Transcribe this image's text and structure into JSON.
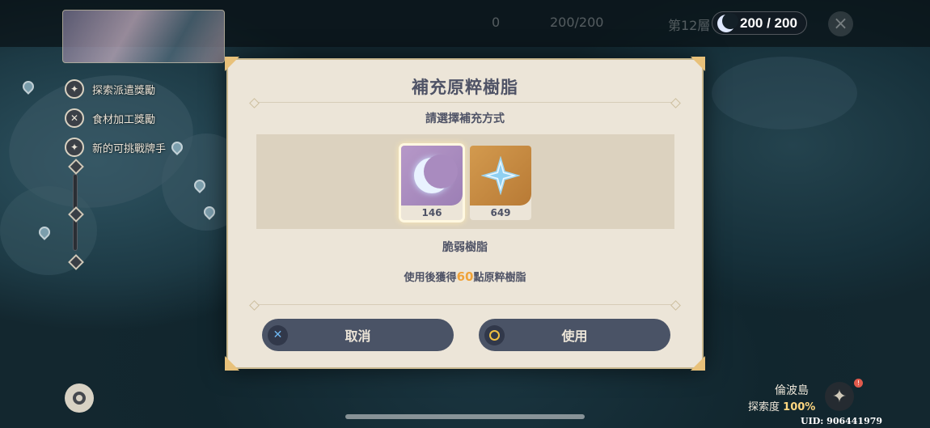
{
  "top_bar": {
    "dim_primo": "0",
    "dim_resin": "200/200",
    "dim_floor": "第12層",
    "resin_display": "200 / 200"
  },
  "left_menu": {
    "items": [
      {
        "label": "探索派遣獎勵",
        "icon": "compass-icon"
      },
      {
        "label": "食材加工獎勵",
        "icon": "cooking-icon"
      },
      {
        "label": "新的可挑戰牌手",
        "icon": "card-icon"
      }
    ]
  },
  "dialog": {
    "title": "補充原粹樹脂",
    "subtitle": "請選擇補充方式",
    "options": [
      {
        "name": "fragile-resin",
        "count": "146",
        "selected": true,
        "icon": "crescent-moon-icon"
      },
      {
        "name": "primogem",
        "count": "649",
        "selected": false,
        "icon": "primogem-star-icon"
      }
    ],
    "selected_item_name": "脆弱樹脂",
    "desc_prefix": "使用後獲得",
    "desc_amount": "60",
    "desc_suffix": "點原粹樹脂",
    "cancel_label": "取消",
    "use_label": "使用"
  },
  "footer": {
    "region_name": "倫波島",
    "explore_label": "探索度",
    "explore_value": "100%",
    "uid": "UID: 906441979"
  },
  "colors": {
    "accent_gold": "#f0a33a",
    "dialog_bg": "#ece5d8",
    "button_bg": "#4a5366",
    "text_dark": "#4f5366"
  }
}
